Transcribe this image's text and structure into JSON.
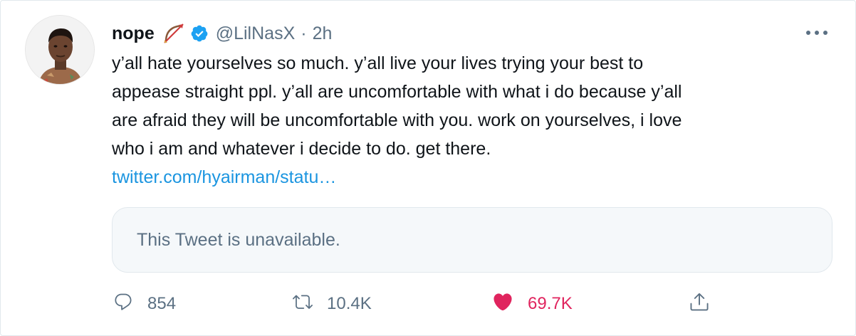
{
  "author": {
    "display_name": "nope",
    "name_emoji": "bow-and-arrow-emoji",
    "verified": true,
    "handle": "@LilNasX",
    "separator": "·",
    "time": "2h"
  },
  "tweet": {
    "lines": [
      "y’all hate yourselves so much. y’all live your lives trying your best to",
      "appease straight ppl. y’all are uncomfortable with what i do because y’all",
      "are afraid they will be uncomfortable with you. work on yourselves, i love",
      "who i am and whatever i decide to do. get there."
    ],
    "link": "twitter.com/hyairman/statu…"
  },
  "quoted_tweet": {
    "text": "This Tweet is unavailable."
  },
  "actions": {
    "reply_count": "854",
    "retweet_count": "10.4K",
    "like_count": "69.7K",
    "liked": true
  },
  "colors": {
    "text": "#0f1419",
    "secondary": "#5b7083",
    "link": "#1b95e0",
    "like": "#e0245e",
    "verified": "#1da1f2",
    "quote_bg": "#f5f8fa",
    "border": "#e1e8ed"
  },
  "icons": [
    "avatar",
    "bow-and-arrow-emoji",
    "verified-badge-icon",
    "more-options-icon",
    "reply-icon",
    "retweet-icon",
    "heart-icon",
    "share-icon"
  ]
}
